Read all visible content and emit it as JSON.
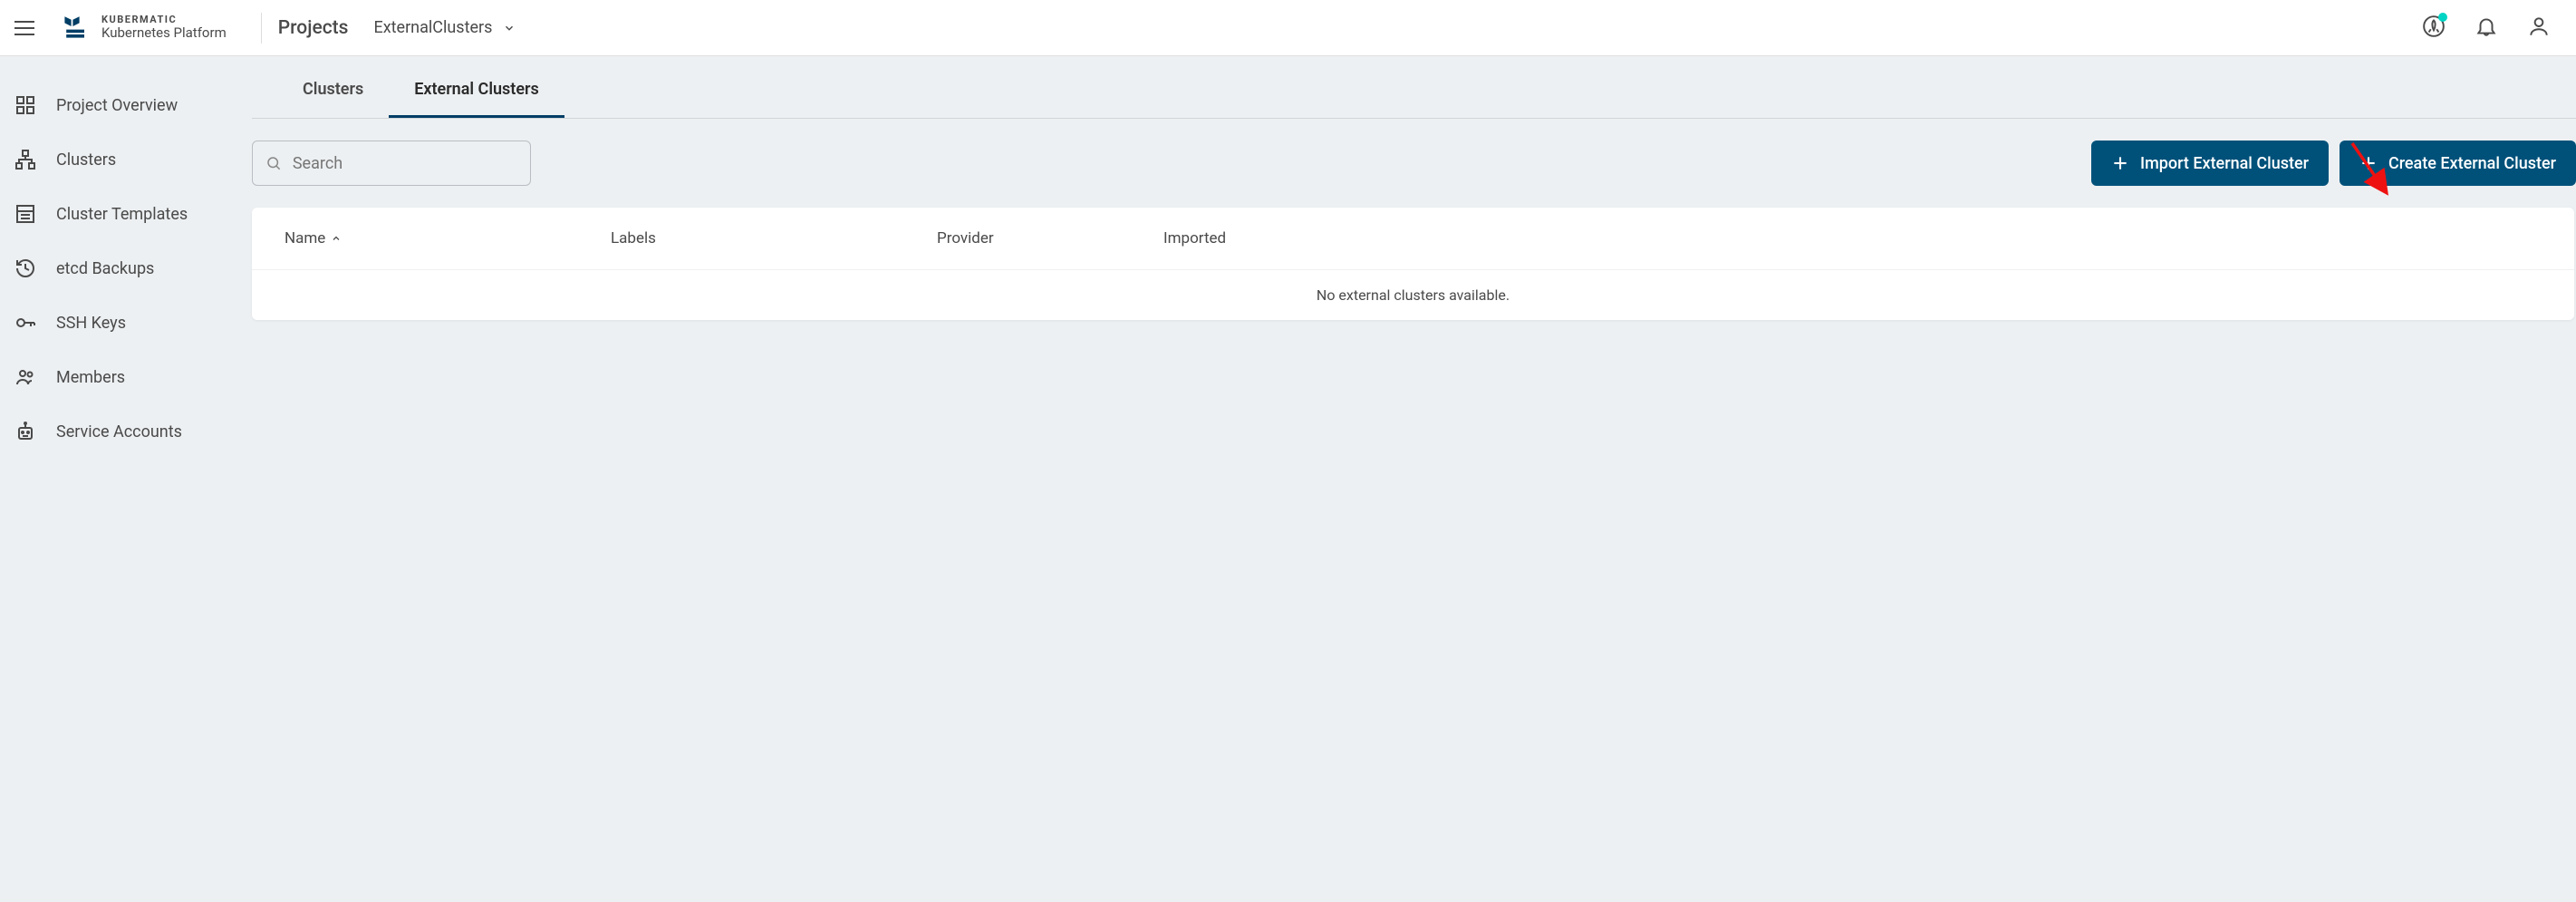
{
  "header": {
    "brand_top": "KUBERMATIC",
    "brand_bottom": "Kubernetes Platform",
    "breadcrumb_root": "Projects",
    "breadcrumb_current": "ExternalClusters"
  },
  "sidebar": {
    "items": [
      {
        "label": "Project Overview"
      },
      {
        "label": "Clusters"
      },
      {
        "label": "Cluster Templates"
      },
      {
        "label": "etcd Backups"
      },
      {
        "label": "SSH Keys"
      },
      {
        "label": "Members"
      },
      {
        "label": "Service Accounts"
      }
    ]
  },
  "tabs": {
    "clusters": "Clusters",
    "external": "External Clusters"
  },
  "toolbar": {
    "search_placeholder": "Search",
    "import_label": "Import External Cluster",
    "create_label": "Create External Cluster"
  },
  "table": {
    "headers": {
      "name": "Name",
      "labels": "Labels",
      "provider": "Provider",
      "imported": "Imported"
    },
    "empty_message": "No external clusters available."
  }
}
